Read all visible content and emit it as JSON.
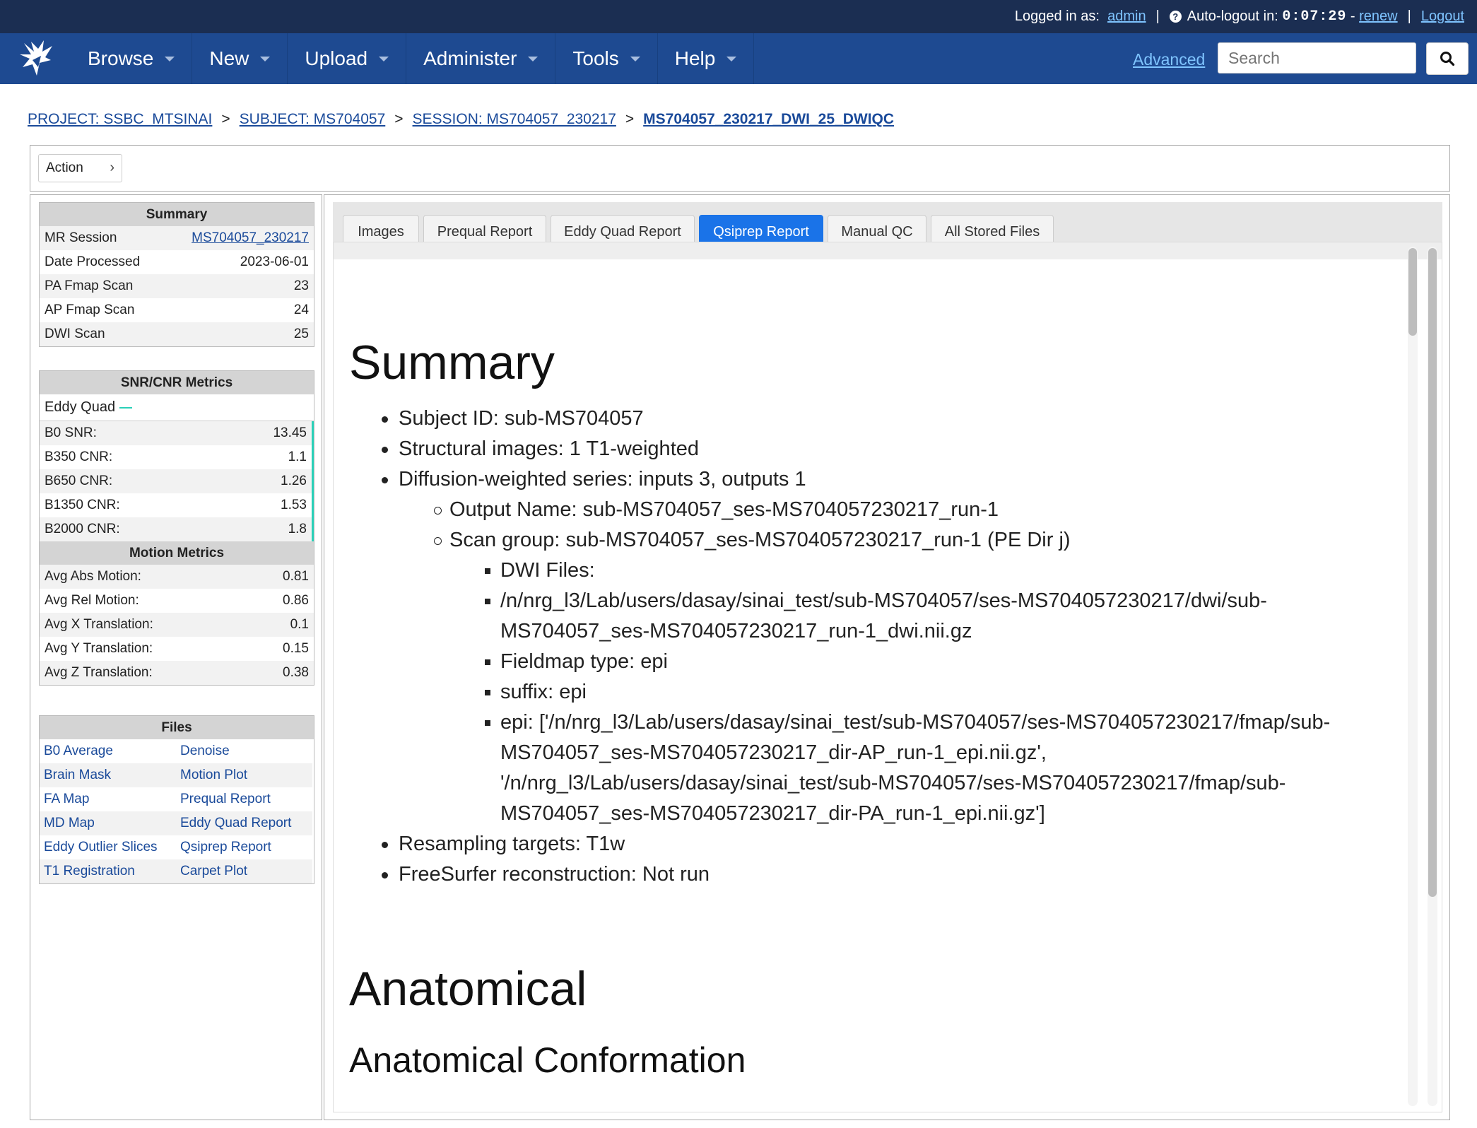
{
  "topbar": {
    "logged_in_label": "Logged in as:",
    "username": "admin",
    "autologout_label": "Auto-logout in:",
    "timer": "0:07:29",
    "timer_sep": "-",
    "renew": "renew",
    "logout": "Logout",
    "divider": "|"
  },
  "nav": {
    "items": [
      {
        "label": "Browse"
      },
      {
        "label": "New"
      },
      {
        "label": "Upload"
      },
      {
        "label": "Administer"
      },
      {
        "label": "Tools"
      },
      {
        "label": "Help"
      }
    ],
    "advanced": "Advanced",
    "search_placeholder": "Search"
  },
  "breadcrumb": {
    "project": "PROJECT: SSBC_MTSINAI",
    "subject": "SUBJECT: MS704057",
    "session": "SESSION: MS704057_230217",
    "current": "MS704057_230217_DWI_25_DWIQC",
    "sep": ">"
  },
  "action": {
    "label": "Action"
  },
  "summary": {
    "title": "Summary",
    "rows": [
      {
        "label": "MR Session",
        "value": "MS704057_230217"
      },
      {
        "label": "Date Processed",
        "value": "2023-06-01"
      },
      {
        "label": "PA Fmap Scan",
        "value": "23"
      },
      {
        "label": "AP Fmap Scan",
        "value": "24"
      },
      {
        "label": "DWI Scan",
        "value": "25"
      }
    ]
  },
  "snr": {
    "title": "SNR/CNR Metrics",
    "eddy_label": "Eddy Quad",
    "rows": [
      {
        "label": "B0 SNR:",
        "value": "13.45"
      },
      {
        "label": "B350 CNR:",
        "value": "1.1"
      },
      {
        "label": "B650 CNR:",
        "value": "1.26"
      },
      {
        "label": "B1350 CNR:",
        "value": "1.53"
      },
      {
        "label": "B2000 CNR:",
        "value": "1.8"
      }
    ]
  },
  "motion": {
    "title": "Motion Metrics",
    "rows": [
      {
        "label": "Avg Abs Motion:",
        "value": "0.81"
      },
      {
        "label": "Avg Rel Motion:",
        "value": "0.86"
      },
      {
        "label": "Avg X Translation:",
        "value": "0.1"
      },
      {
        "label": "Avg Y Translation:",
        "value": "0.15"
      },
      {
        "label": "Avg Z Translation:",
        "value": "0.38"
      }
    ]
  },
  "files": {
    "title": "Files",
    "links": [
      "B0 Average",
      "Denoise",
      "Brain Mask",
      "Motion Plot",
      "FA Map",
      "Prequal Report",
      "MD Map",
      "Eddy Quad Report",
      "Eddy Outlier Slices",
      "Qsiprep Report",
      "T1 Registration",
      "Carpet Plot"
    ]
  },
  "tabs": [
    "Images",
    "Prequal Report",
    "Eddy Quad Report",
    "Qsiprep Report",
    "Manual QC",
    "All Stored Files"
  ],
  "report": {
    "summary_heading": "Summary",
    "subject_id": "Subject ID: sub-MS704057",
    "structural": "Structural images: 1 T1-weighted",
    "diffusion": "Diffusion-weighted series: inputs 3, outputs 1",
    "output_name": "Output Name: sub-MS704057_ses-MS704057230217_run-1",
    "scan_group": "Scan group: sub-MS704057_ses-MS704057230217_run-1 (PE Dir j)",
    "dwi_files": "DWI Files:",
    "dwi_path_1": "/n/nrg_l3/Lab/users/dasay/sinai_test/sub-MS704057/ses-MS704057230217/dwi/sub-",
    "dwi_path_2": "MS704057_ses-MS704057230217_run-1_dwi.nii.gz",
    "fieldmap_type": "Fieldmap type: epi",
    "suffix": "suffix: epi",
    "epi_1": "epi: ['/n/nrg_l3/Lab/users/dasay/sinai_test/sub-MS704057/ses-MS704057230217/fmap/sub-",
    "epi_2": "MS704057_ses-MS704057230217_dir-AP_run-1_epi.nii.gz',",
    "epi_3": "'/n/nrg_l3/Lab/users/dasay/sinai_test/sub-MS704057/ses-MS704057230217/fmap/sub-",
    "epi_4": "MS704057_ses-MS704057230217_dir-PA_run-1_epi.nii.gz']",
    "resampling": "Resampling targets: T1w",
    "freesurfer": "FreeSurfer reconstruction: Not run",
    "anatomical_heading": "Anatomical",
    "anat_conformation": "Anatomical Conformation"
  },
  "colors": {
    "topbar": "#1b2e52",
    "navbar": "#1e4a91",
    "active_tab": "#1a73e8",
    "link": "#1a4a9a",
    "eddy_accent": "#2ad0b8"
  }
}
